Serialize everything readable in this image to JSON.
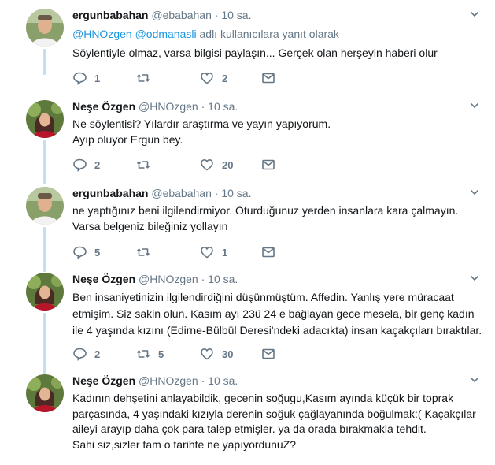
{
  "tweets": [
    {
      "name": "ergunbabahan",
      "handle": "@ebabahan",
      "time": "10 sa.",
      "reply_mentions": [
        "@HNOzgen",
        "@odmanasli"
      ],
      "reply_suffix": "adlı kullanıcılara yanıt olarak",
      "lines": [
        "Söylentiyle olmaz, varsa bilgisi paylaşın... Gerçek olan herşeyin haberi olur"
      ],
      "counts": {
        "reply": "1",
        "retweet": "",
        "like": "2"
      },
      "avatar": "man-avatar"
    },
    {
      "name": "Neşe Özgen",
      "handle": "@HNOzgen",
      "time": "10 sa.",
      "lines": [
        "Ne söylentisi? Yılardır araştırma ve yayın yapıyorum.",
        "Ayıp oluyor Ergun bey."
      ],
      "counts": {
        "reply": "2",
        "retweet": "",
        "like": "20"
      },
      "avatar": "woman-avatar"
    },
    {
      "name": "ergunbabahan",
      "handle": "@ebabahan",
      "time": "10 sa.",
      "lines": [
        "ne yaptığınız beni ilgilendirmiyor. Oturduğunuz yerden insanlara kara çalmayın.",
        "Varsa belgeniz bileğiniz yollayın"
      ],
      "counts": {
        "reply": "5",
        "retweet": "",
        "like": "1"
      },
      "avatar": "man-avatar"
    },
    {
      "name": "Neşe Özgen",
      "handle": "@HNOzgen",
      "time": "10 sa.",
      "lines": [
        "Ben insaniyetinizin ilgilendirdiğini düşünmüştüm. Affedin. Yanlış yere müracaat",
        "etmişim. Siz sakin olun. Kasım ayı 23ü 24 e bağlayan gece mesela, bir genç kadın",
        "ile 4 yaşında kızını (Edirne-Bülbül Deresi'ndeki adacıkta) insan kaçakçıları bıraktılar."
      ],
      "counts": {
        "reply": "2",
        "retweet": "5",
        "like": "30"
      },
      "avatar": "woman-avatar"
    },
    {
      "name": "Neşe Özgen",
      "handle": "@HNOzgen",
      "time": "10 sa.",
      "lines": [
        "Kadının dehşetini anlayabildik, gecenin soğugu,Kasım ayında küçük bir toprak",
        "parçasında, 4 yaşındaki kızıyla derenin soğuk çağlayanında boğulmak:( Kaçakçılar",
        "aileyi arayıp daha çok para talep etmişler. ya da orada bırakmakla tehdit.",
        "Sahi siz,sizler tam o tarihte ne yapıyordunuZ?"
      ],
      "counts": {
        "reply": "",
        "retweet": "",
        "like": ""
      },
      "avatar": "woman-avatar"
    }
  ],
  "icons": {
    "reply": "reply-icon",
    "retweet": "retweet-icon",
    "like": "heart-icon",
    "dm": "envelope-icon",
    "caret": "chevron-down-icon"
  },
  "colors": {
    "text": "#14171a",
    "muted": "#657786",
    "link": "#1b95e0",
    "connector": "#c4dff1",
    "icon": "#657786"
  }
}
